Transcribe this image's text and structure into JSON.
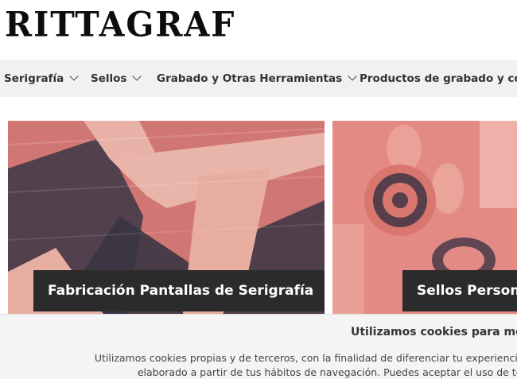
{
  "header": {
    "logo_text": "RITTAGRAF"
  },
  "nav": {
    "items": [
      {
        "label": "Serigrafía",
        "has_dropdown": true
      },
      {
        "label": "Sellos",
        "has_dropdown": true
      },
      {
        "label": "Grabado y Otras Herramientas",
        "has_dropdown": true
      },
      {
        "label": "Productos de grabado y corte",
        "has_dropdown": true
      }
    ]
  },
  "cards": [
    {
      "label": "Fabricación Pantallas de Serigrafía"
    },
    {
      "label": "Sellos Personalizados"
    }
  ],
  "cookie_banner": {
    "title": "Utilizamos cookies para mejorar tu experiencia",
    "line1": "Utilizamos cookies propias y de terceros, con la finalidad de diferenciar tu experiencia de la de otros usuarios",
    "line2": "elaborado a partir de tus hábitos de navegación. Puedes aceptar el uso de todas las cookies"
  },
  "colors": {
    "nav_background": "#f1f1f1",
    "card_overlay": "#d47a76",
    "card_label_background": "#2b2b2b",
    "cookie_background": "#f4f4f4"
  }
}
